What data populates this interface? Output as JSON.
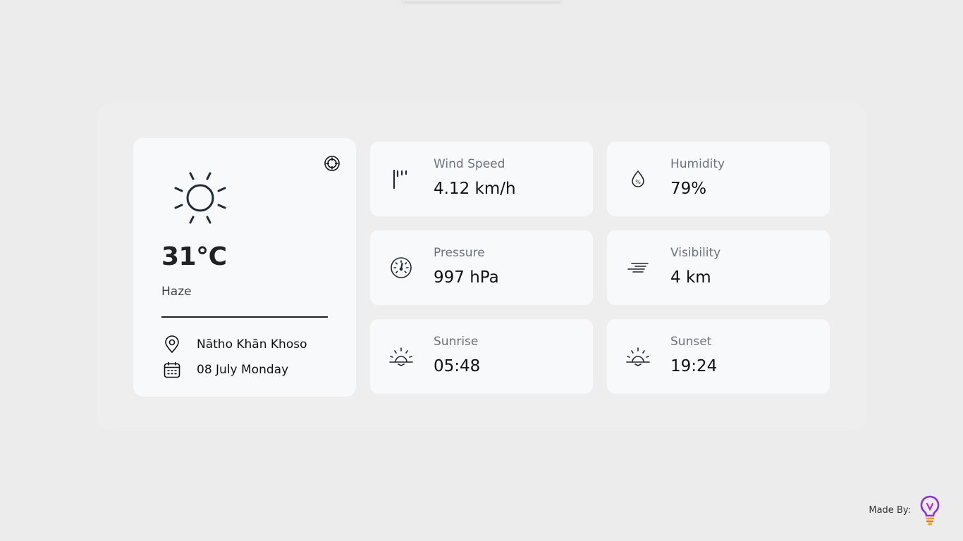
{
  "current": {
    "temperature": "31°C",
    "condition": "Haze",
    "location": "Nātho Khān Khoso",
    "date": "08 July Monday"
  },
  "stats": {
    "wind": {
      "label": "Wind Speed",
      "value": "4.12 km/h"
    },
    "humidity": {
      "label": "Humidity",
      "value": "79%"
    },
    "pressure": {
      "label": "Pressure",
      "value": "997 hPa"
    },
    "visibility": {
      "label": "Visibility",
      "value": "4 km"
    },
    "sunrise": {
      "label": "Sunrise",
      "value": "05:48"
    },
    "sunset": {
      "label": "Sunset",
      "value": "19:24"
    }
  },
  "footer": {
    "made_by": "Made By:"
  },
  "icons": {
    "weather": "sun-icon",
    "locate": "crosshair-icon",
    "location": "map-pin-icon",
    "date": "calendar-icon",
    "wind": "windsock-icon",
    "humidity": "droplet-percent-icon",
    "pressure": "gauge-icon",
    "visibility": "fog-icon",
    "sunrise": "sunrise-icon",
    "sunset": "sunset-icon",
    "brand": "lightbulb-logo-icon"
  },
  "colors": {
    "background": "#ececec",
    "card": "#f8f9fa",
    "label": "#6b7280",
    "icon": "#1f2937",
    "brand_purple": "#8b2fe0",
    "brand_orange": "#f59e0b"
  }
}
